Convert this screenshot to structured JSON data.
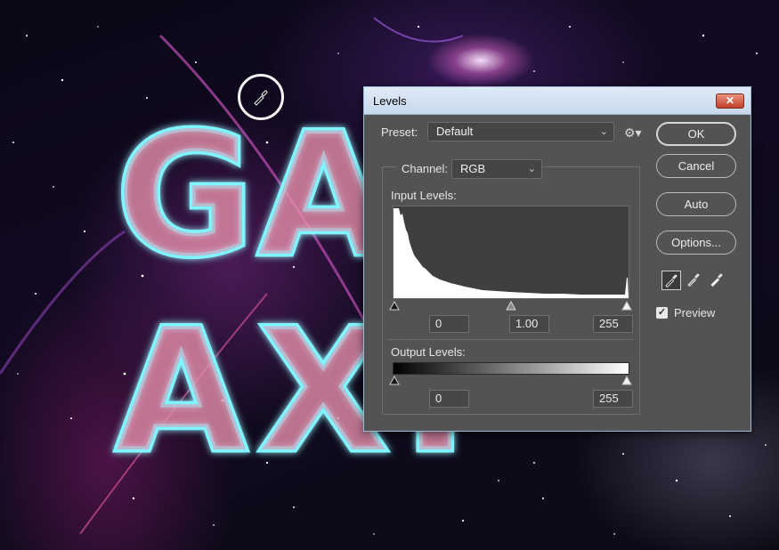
{
  "dialog": {
    "title": "Levels",
    "close_glyph": "✕",
    "preset_label": "Preset:",
    "preset_value": "Default",
    "channel_label": "Channel:",
    "channel_value": "RGB",
    "input_levels_label": "Input Levels:",
    "input_black": "0",
    "input_gamma": "1.00",
    "input_white": "255",
    "output_levels_label": "Output Levels:",
    "output_black": "0",
    "output_white": "255",
    "buttons": {
      "ok": "OK",
      "cancel": "Cancel",
      "auto": "Auto",
      "options": "Options..."
    },
    "preview_label": "Preview",
    "preview_checked": true,
    "icons": [
      "gear-icon",
      "eyedropper-black-icon",
      "eyedropper-gray-icon",
      "eyedropper-white-icon",
      "checkmark-icon",
      "chevron-down-icon"
    ]
  },
  "colors": {
    "dialog_bg": "#535353",
    "titlebar": "#d6e4f3",
    "close_button": "#c4402c",
    "histogram": "#ffffff"
  }
}
